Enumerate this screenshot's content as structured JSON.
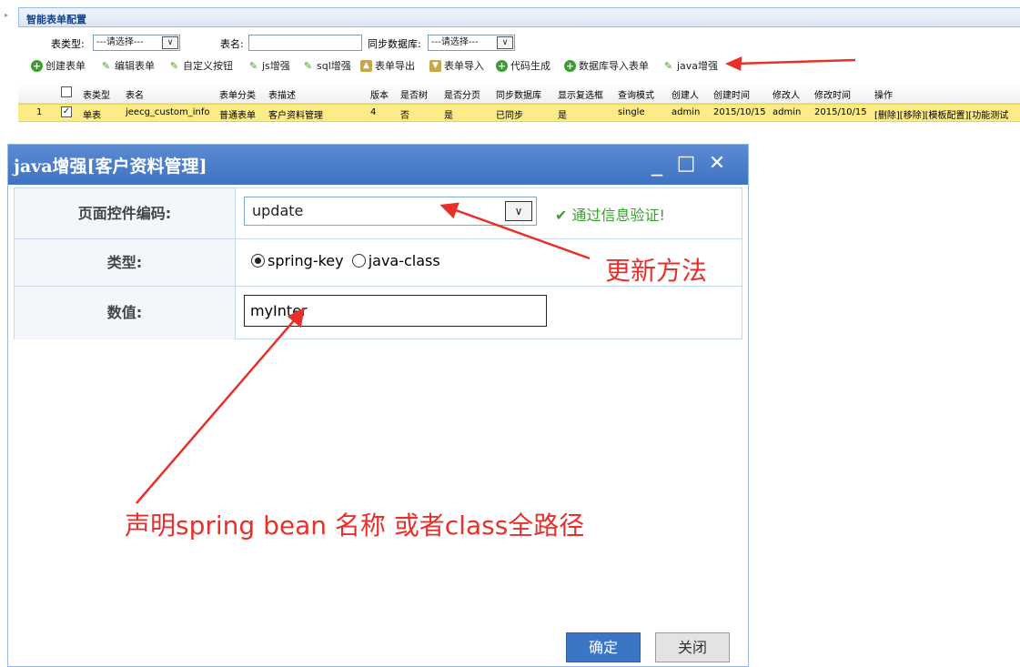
{
  "panel": {
    "title": "智能表单配置",
    "search": {
      "table_type_label": "表类型:",
      "table_type_value": "---请选择---",
      "table_name_label": "表名:",
      "table_name_value": "",
      "sync_label": "同步数据库:",
      "sync_value": "---请选择---"
    },
    "toolbar": [
      {
        "label": "创建表单",
        "icon": "plus-circle-icon"
      },
      {
        "label": "编辑表单",
        "icon": "pencil-icon"
      },
      {
        "label": "自定义按钮",
        "icon": "pencil-icon"
      },
      {
        "label": "js增强",
        "icon": "pencil-icon"
      },
      {
        "label": "sql增强",
        "icon": "pencil-icon"
      },
      {
        "label": "表单导出",
        "icon": "export-icon"
      },
      {
        "label": "表单导入",
        "icon": "import-icon"
      },
      {
        "label": "代码生成",
        "icon": "plus-circle-icon"
      },
      {
        "label": "数据库导入表单",
        "icon": "plus-circle-icon"
      },
      {
        "label": "java增强",
        "icon": "pencil-icon"
      }
    ],
    "grid": {
      "columns": [
        "表类型",
        "表名",
        "表单分类",
        "表描述",
        "版本",
        "是否树",
        "是否分页",
        "同步数据库",
        "显示复选框",
        "查询模式",
        "创建人",
        "创建时间",
        "修改人",
        "修改时间",
        "操作"
      ],
      "row": {
        "index": "1",
        "checked": true,
        "values": [
          "单表",
          "jeecg_custom_info",
          "普通表单",
          "客户资料管理",
          "4",
          "否",
          "是",
          "已同步",
          "是",
          "single",
          "admin",
          "2015/10/15",
          "admin",
          "2015/10/15",
          "[删除][移除][模板配置][功能测试"
        ]
      }
    }
  },
  "dialog": {
    "title": "java增强[客户资料管理]",
    "controls": {
      "minimize": "_",
      "maximize": "□",
      "close": "✕"
    },
    "form": {
      "code_label": "页面控件编码:",
      "code_value": "update",
      "validation": "通过信息验证!",
      "type_label": "类型:",
      "type_option_1": "spring-key",
      "type_option_2": "java-class",
      "type_selected": "spring-key",
      "value_label": "数值:",
      "value_value": "myInter"
    },
    "buttons": {
      "ok": "确定",
      "close": "关闭"
    }
  },
  "annotations": {
    "update_method": "更新方法",
    "bean_hint": "声明spring bean 名称 或者class全路径"
  },
  "colors": {
    "annotation": "#e8302a",
    "dialog_header": "#4a7fcb",
    "selected_row": "#fbec88",
    "valid": "#3aa02e"
  }
}
